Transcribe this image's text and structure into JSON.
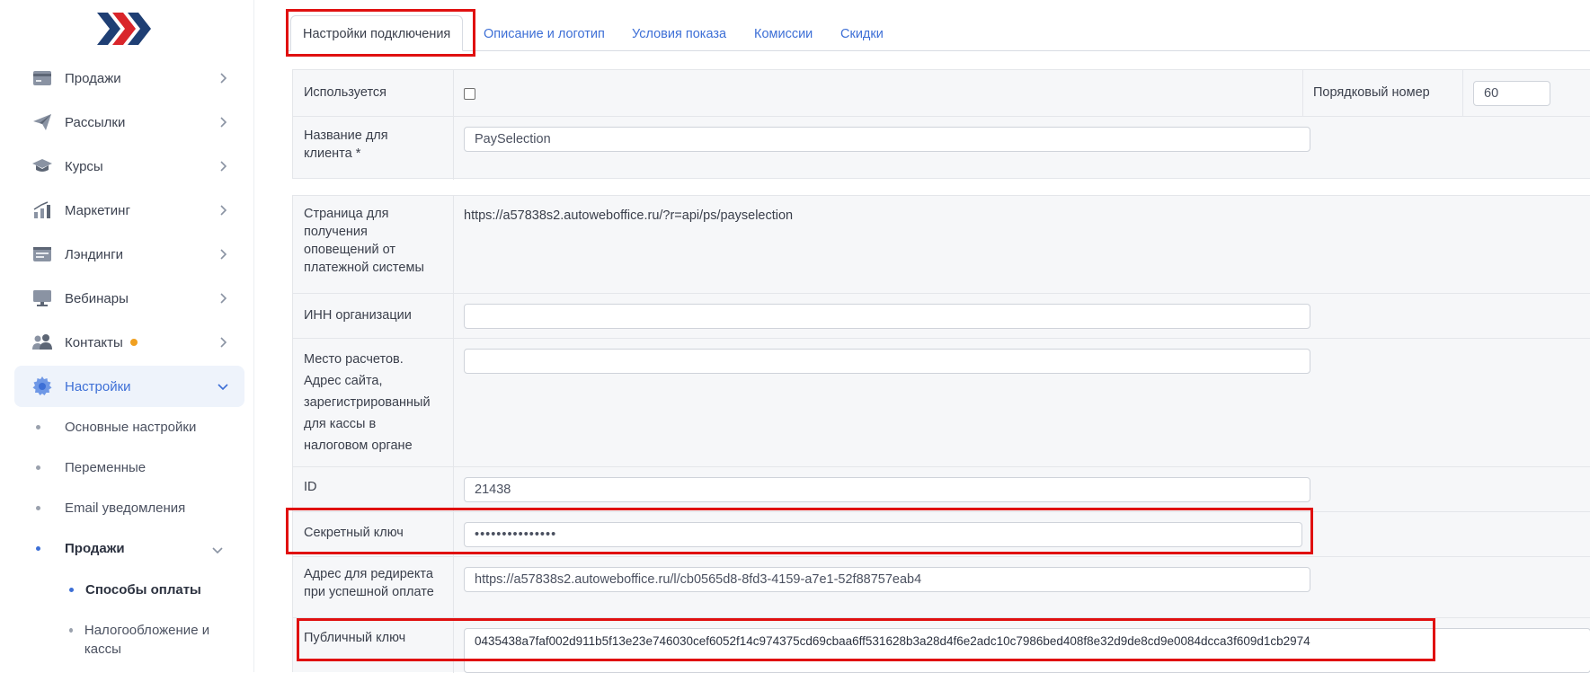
{
  "sidebar": {
    "items": [
      {
        "label": "Продажи",
        "icon": "card-icon"
      },
      {
        "label": "Рассылки",
        "icon": "paper-plane-icon"
      },
      {
        "label": "Курсы",
        "icon": "graduation-cap-icon"
      },
      {
        "label": "Маркетинг",
        "icon": "bar-chart-icon"
      },
      {
        "label": "Лэндинги",
        "icon": "landing-page-icon"
      },
      {
        "label": "Вебинары",
        "icon": "monitor-icon"
      },
      {
        "label": "Контакты",
        "icon": "users-icon"
      },
      {
        "label": "Настройки",
        "icon": "gear-icon"
      }
    ],
    "sub_items": [
      {
        "label": "Основные настройки"
      },
      {
        "label": "Переменные"
      },
      {
        "label": "Email уведомления"
      },
      {
        "label": "Продажи"
      }
    ],
    "sub2_items": [
      {
        "label": "Способы оплаты"
      },
      {
        "label": "Налогообложение и кассы"
      }
    ]
  },
  "tabs": [
    {
      "label": "Настройки подключения"
    },
    {
      "label": "Описание и логотип"
    },
    {
      "label": "Условия показа"
    },
    {
      "label": "Комиссии"
    },
    {
      "label": "Скидки"
    }
  ],
  "form": {
    "used_label": "Используется",
    "order_label": "Порядковый номер",
    "order_value": "60",
    "name_label": "Название для клиента *",
    "name_value": "PaySelection",
    "notify_label": "Страница для получения оповещений от платежной системы",
    "notify_value": "https://a57838s2.autoweboffice.ru/?r=api/ps/payselection",
    "inn_label": "ИНН организации",
    "inn_value": "",
    "place_label": "Место расчетов. Адрес сайта, зарегистрированный для кассы в налоговом органе",
    "place_value": "",
    "id_label": "ID",
    "id_value": "21438",
    "secret_label": "Секретный ключ",
    "secret_value": "•••••••••••••••",
    "redirect_label": "Адрес для редиректа при успешной оплате",
    "redirect_value": "https://a57838s2.autoweboffice.ru/l/cb0565d8-8fd3-4159-a7e1-52f88757eab4",
    "public_label": "Публичный ключ",
    "public_value": "0435438a7faf002d911b5f13e23e746030cef6052f14c974375cd69cbaa6ff531628b3a28d4f6e2adc10c7986bed408f8e32d9de8cd9e0084dcca3f609d1cb2974"
  },
  "colors": {
    "accent": "#3d6fd6",
    "highlight": "#e01010",
    "logo_red": "#d9252b",
    "logo_navy": "#1f3f74"
  }
}
